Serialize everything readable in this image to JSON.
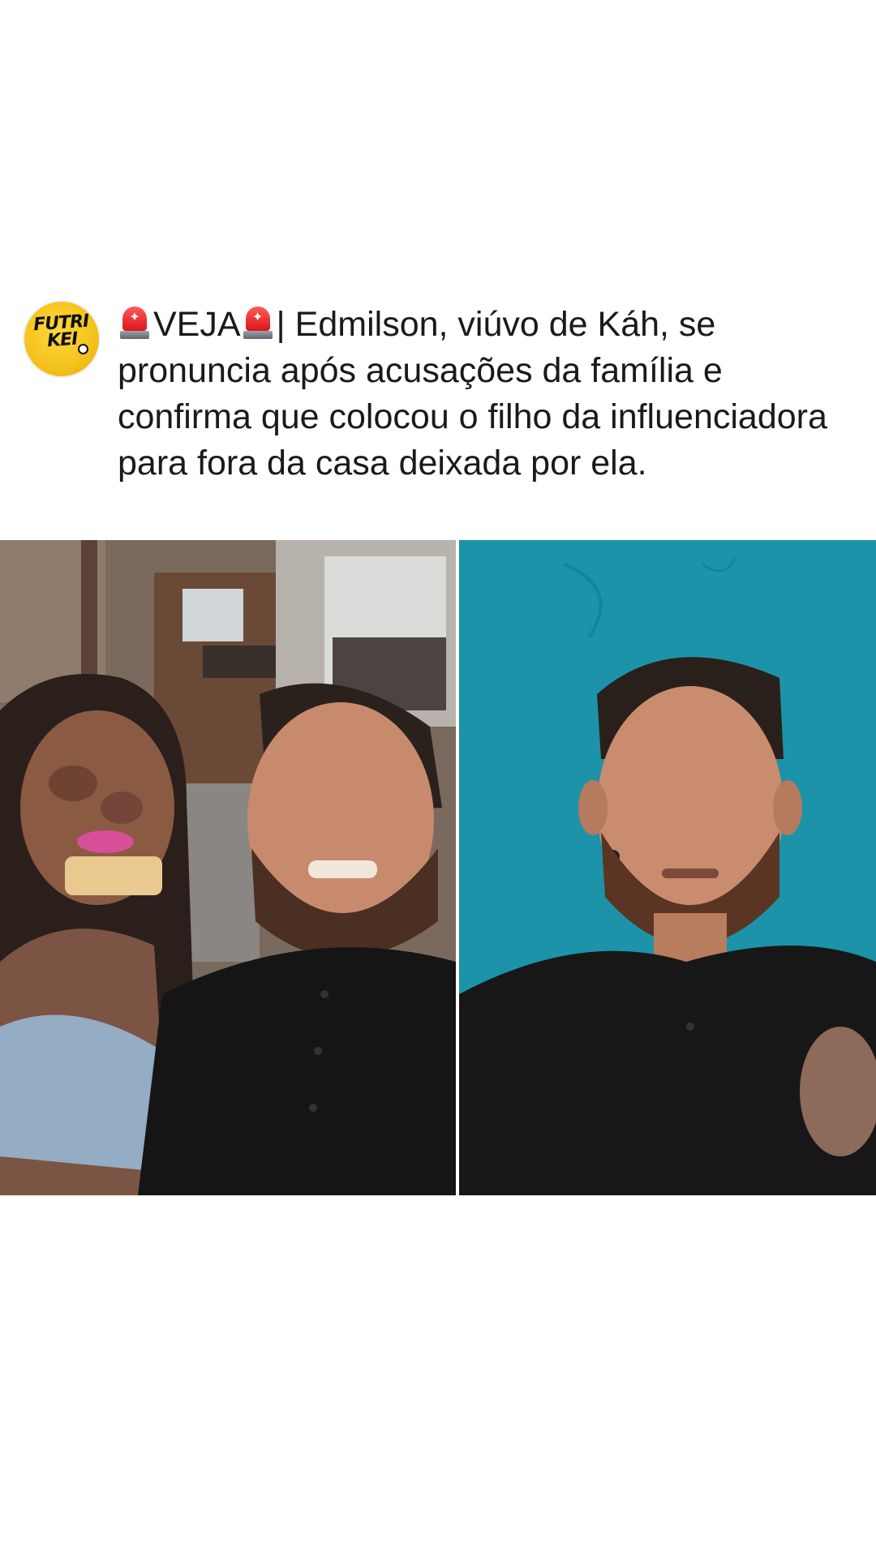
{
  "post": {
    "avatar": {
      "name": "FUTRI KEI",
      "line1": "FUTRI",
      "line2": "KEI"
    },
    "caption": {
      "tag": "VEJA",
      "separator": "|",
      "text": "Edmilson, viúvo de Káh, se pronuncia após acusações da família e confirma que colocou o filho da influenciadora para fora da casa deixada por ela.",
      "icon": "police-siren-icon"
    },
    "images": {
      "left": "photo-couple-selfie",
      "right": "photo-man-blue-wall"
    },
    "colors": {
      "avatar_bg": "#f4c21c",
      "siren": "#d8161d",
      "right_wall": "#1a8ca2"
    }
  }
}
